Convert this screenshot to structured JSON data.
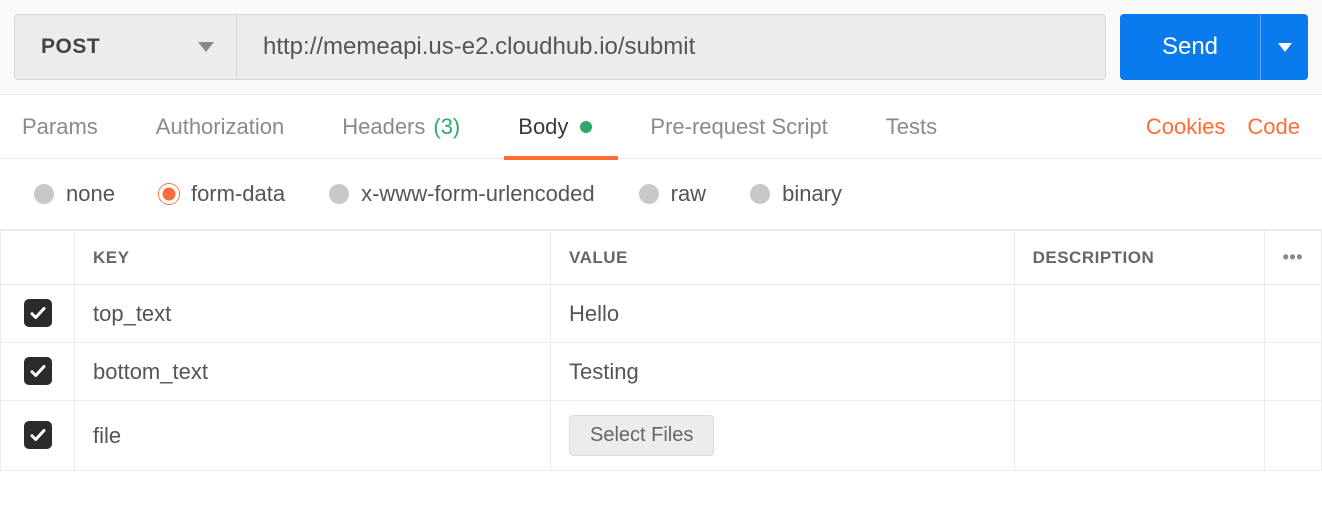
{
  "request": {
    "method": "POST",
    "url": "http://memeapi.us-e2.cloudhub.io/submit",
    "send_label": "Send"
  },
  "tabs": {
    "params": "Params",
    "auth": "Authorization",
    "headers_label": "Headers",
    "headers_count": "(3)",
    "body": "Body",
    "prerequest": "Pre-request Script",
    "tests": "Tests"
  },
  "links": {
    "cookies": "Cookies",
    "code": "Code"
  },
  "body_types": {
    "none": "none",
    "form_data": "form-data",
    "x_www": "x-www-form-urlencoded",
    "raw": "raw",
    "binary": "binary",
    "selected": "form-data"
  },
  "table": {
    "headers": {
      "key": "KEY",
      "value": "VALUE",
      "desc": "DESCRIPTION"
    },
    "rows": [
      {
        "checked": true,
        "key": "top_text",
        "value_text": "Hello"
      },
      {
        "checked": true,
        "key": "bottom_text",
        "value_text": "Testing"
      },
      {
        "checked": true,
        "key": "file",
        "is_file": true,
        "file_button": "Select Files"
      }
    ]
  }
}
